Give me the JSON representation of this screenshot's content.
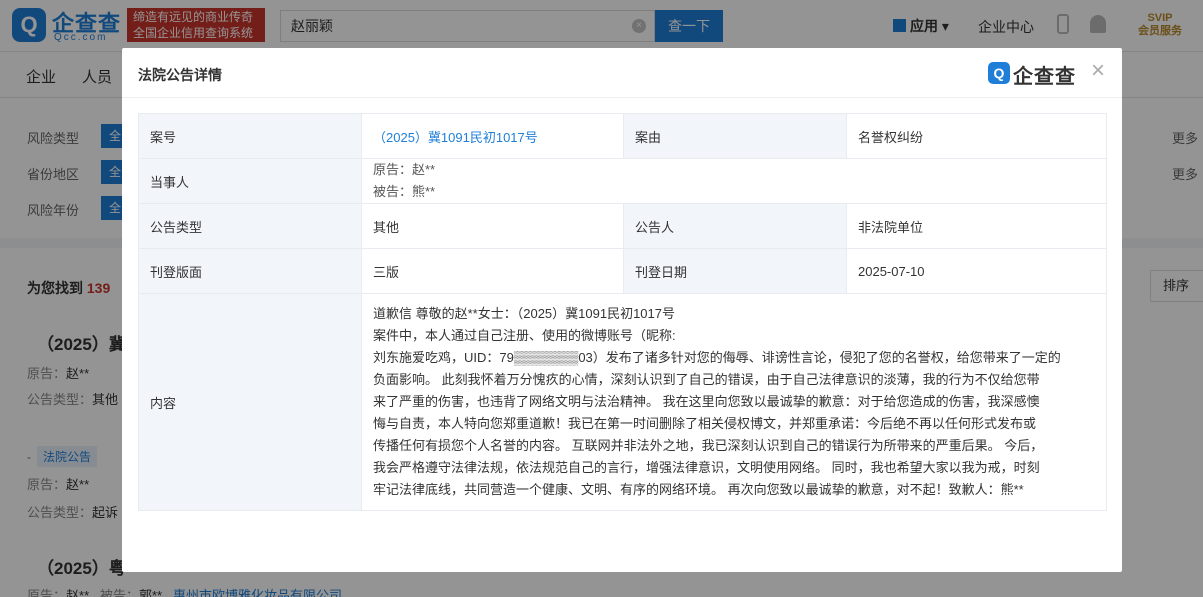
{
  "brand": {
    "logo_glyph": "Q",
    "name_cn": "企查查",
    "name_en": "Qcc.com",
    "slogan_line1": "缔造有远见的商业传奇",
    "slogan_line2": "全国企业信用查询系统"
  },
  "search": {
    "value": "赵丽颖",
    "button": "查一下"
  },
  "header": {
    "apps_label": "应用",
    "enterprise_center": "企业中心",
    "svip_top": "SVIP",
    "svip_bottom": "会员服务"
  },
  "nav": {
    "tabs": [
      "企业",
      "人员"
    ]
  },
  "filters": [
    {
      "label": "风险类型",
      "value": "全",
      "more": "更多"
    },
    {
      "label": "省份地区",
      "value": "全",
      "more": "更多"
    },
    {
      "label": "风险年份",
      "value": "全"
    }
  ],
  "results": {
    "found_prefix": "为您找到",
    "found_count": "139",
    "sort_label": "排序",
    "items": [
      {
        "title": "（2025）冀",
        "line1_label": "原告：",
        "line1_value": "赵**",
        "line2_label": "公告类型：",
        "line2_value": "其他"
      },
      {
        "tag_prefix": "-",
        "tag": "法院公告",
        "line1_label": "原告：",
        "line1_value": "赵**",
        "line2_label": "公告类型：",
        "line2_value": "起诉"
      },
      {
        "title": "（2025）粤",
        "line1_label": "原告：",
        "line1_value": "赵**",
        "line1b_label": "被告：",
        "line1b_value": "郭**",
        "company": "惠州市欧博雅化妆品有限公司"
      }
    ]
  },
  "modal": {
    "title": "法院公告详情",
    "logo_glyph": "Q",
    "logo_text": "企查查",
    "close": "×",
    "rows": {
      "case_no_label": "案号",
      "case_no": "（2025）冀1091民初1017号",
      "cause_label": "案由",
      "cause": "名誉权纠纷",
      "party_label": "当事人",
      "plaintiff": "原告：赵**",
      "defendant": "被告：熊**",
      "type_label": "公告类型",
      "type": "其他",
      "announcer_label": "公告人",
      "announcer": "非法院单位",
      "edition_label": "刊登版面",
      "edition": "三版",
      "date_label": "刊登日期",
      "date": "2025-07-10",
      "content_label": "内容",
      "content_lines": [
        "道歉信 尊敬的赵**女士：（2025）冀1091民初1017号",
        "案件中，本人通过自己注册、使用的微博账号（昵称:",
        "刘东施爱吃鸡，UID：79▒▒▒▒▒▒▒03）发布了诸多针对您的侮辱、诽谤性言论，侵犯了您的名誉权，给您带来了一定的",
        "负面影响。 此刻我怀着万分愧疚的心情，深刻认识到了自己的错误，由于自己法律意识的淡薄，我的行为不仅给您带",
        "来了严重的伤害，也违背了网络文明与法治精神。 我在这里向您致以最诚挚的歉意：对于给您造成的伤害，我深感懊",
        "悔与自责，本人特向您郑重道歉！我已在第一时间删除了相关侵权博文，并郑重承诺：今后绝不再以任何形式发布或",
        "传播任何有损您个人名誉的内容。 互联网并非法外之地，我已深刻认识到自己的错误行为所带来的严重后果。 今后，",
        "我会严格遵守法律法规，依法规范自己的言行，增强法律意识，文明使用网络。 同时，我也希望大家以我为戒，时刻",
        "牢记法律底线，共同营造一个健康、文明、有序的网络环境。 再次向您致以最诚挚的歉意，对不起！致歉人：熊**"
      ]
    }
  }
}
